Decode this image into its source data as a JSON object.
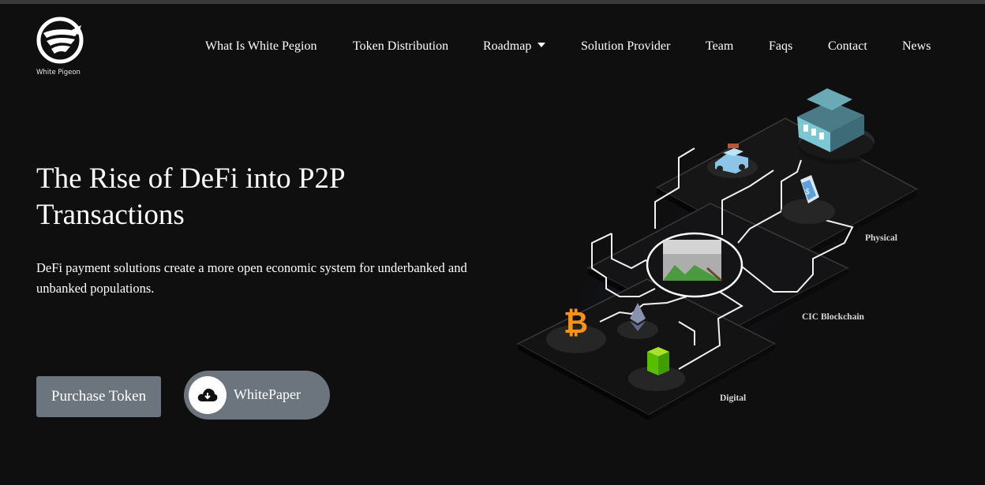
{
  "brand": {
    "name": "White Pigeon"
  },
  "nav": {
    "items": [
      {
        "label": "What Is White Pegion"
      },
      {
        "label": "Token Distribution"
      },
      {
        "label": "Roadmap",
        "dropdown": true
      },
      {
        "label": "Solution Provider"
      },
      {
        "label": "Team"
      },
      {
        "label": "Faqs"
      },
      {
        "label": "Contact"
      },
      {
        "label": "News"
      }
    ]
  },
  "hero": {
    "title": "The Rise of DeFi into P2P Transactions",
    "subtitle": "DeFi payment solutions create a more open economic system for underbanked and unbanked populations.",
    "purchase_label": "Purchase Token",
    "whitepaper_label": "WhitePaper"
  },
  "illustration": {
    "layer_labels": {
      "physical": "Physical",
      "blockchain": "CIC Blockchain",
      "digital": "Digital"
    },
    "icons": [
      "house-icon",
      "car-icon",
      "phone-icon",
      "bitcoin-icon",
      "ethereum-icon",
      "neo-icon",
      "broken-image-icon"
    ]
  },
  "colors": {
    "background": "#0f0f10",
    "button": "#6c757d",
    "bitcoin": "#f7931a",
    "neo": "#58bf00",
    "house": "#5aa7b5"
  }
}
